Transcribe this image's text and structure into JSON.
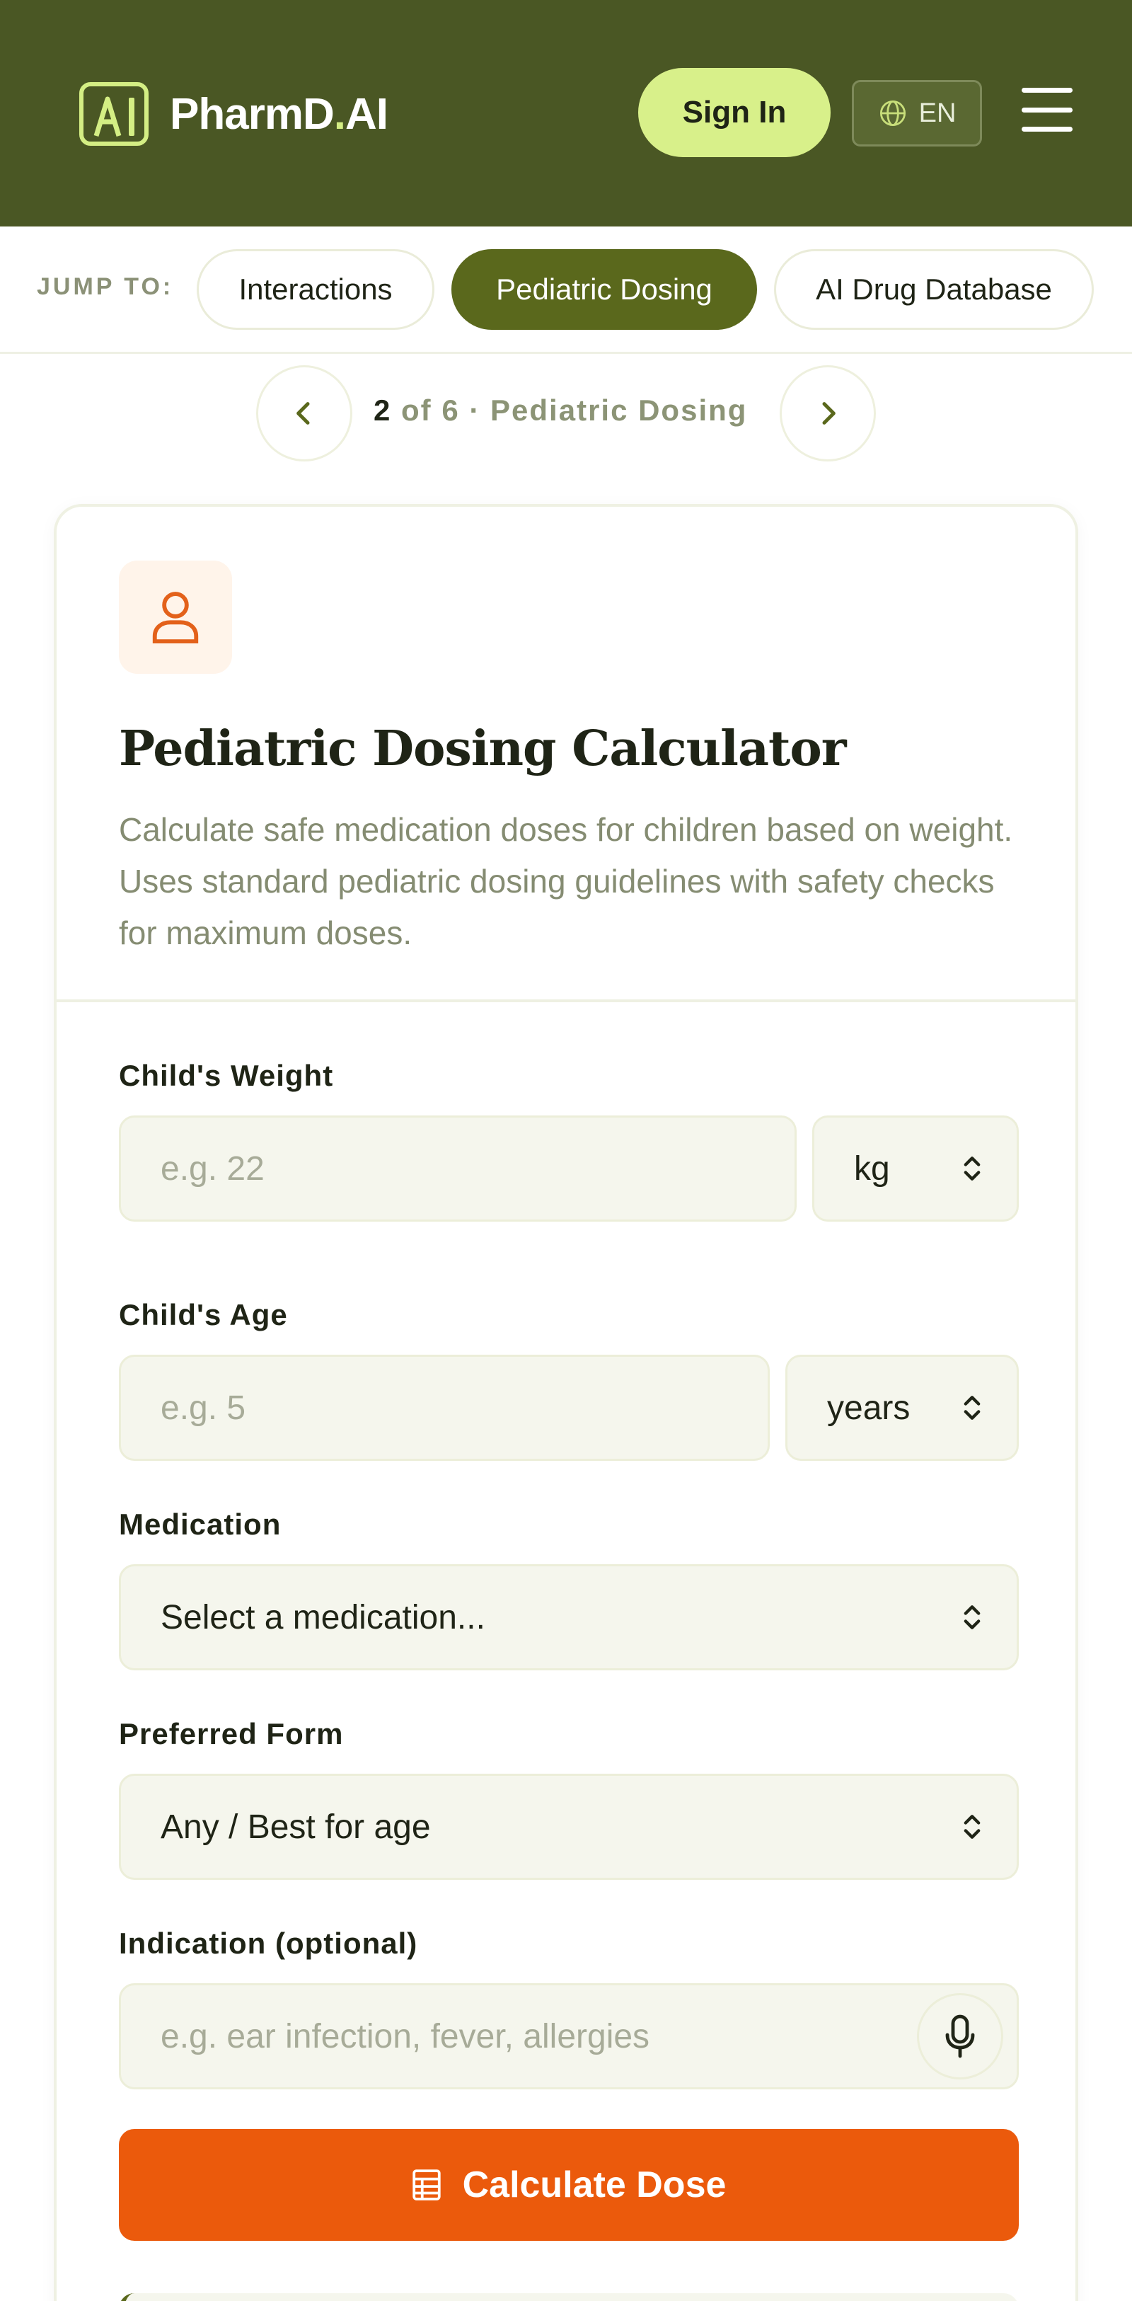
{
  "brand": {
    "name_main": "PharmD",
    "name_dot": ".",
    "name_tail": "AI",
    "logo_letters": "AI"
  },
  "header": {
    "signin_label": "Sign In",
    "lang_label": "EN"
  },
  "jump": {
    "label": "JUMP TO:",
    "chips": [
      {
        "label": "Interactions",
        "active": false
      },
      {
        "label": "Pediatric Dosing",
        "active": true
      },
      {
        "label": "AI Drug Database",
        "active": false
      }
    ]
  },
  "pager": {
    "current": "2",
    "rest": " of 6 · Pediatric Dosing"
  },
  "card": {
    "title": "Pediatric Dosing Calculator",
    "description": "Calculate safe medication doses for children based on weight. Uses standard pediatric dosing guidelines with safety checks for maximum doses."
  },
  "form": {
    "weight": {
      "label": "Child's Weight",
      "placeholder": "e.g. 22",
      "unit": "kg"
    },
    "age": {
      "label": "Child's Age",
      "placeholder": "e.g. 5",
      "unit": "years"
    },
    "medication": {
      "label": "Medication",
      "value": "Select a medication..."
    },
    "form_pref": {
      "label": "Preferred Form",
      "value": "Any / Best for age"
    },
    "indication": {
      "label": "Indication (optional)",
      "placeholder": "e.g. ear infection, fever, allergies"
    },
    "submit_label": "Calculate Dose"
  },
  "colors": {
    "header_bg": "#4a5724",
    "accent_lime": "#d8f08a",
    "accent_olive": "#5a681c",
    "cta_orange": "#eb5a0c"
  },
  "icons": [
    "globe-icon",
    "menu-icon",
    "chevron-left-icon",
    "chevron-right-icon",
    "user-icon",
    "select-chevron-icon",
    "mic-icon",
    "calculator-icon"
  ]
}
